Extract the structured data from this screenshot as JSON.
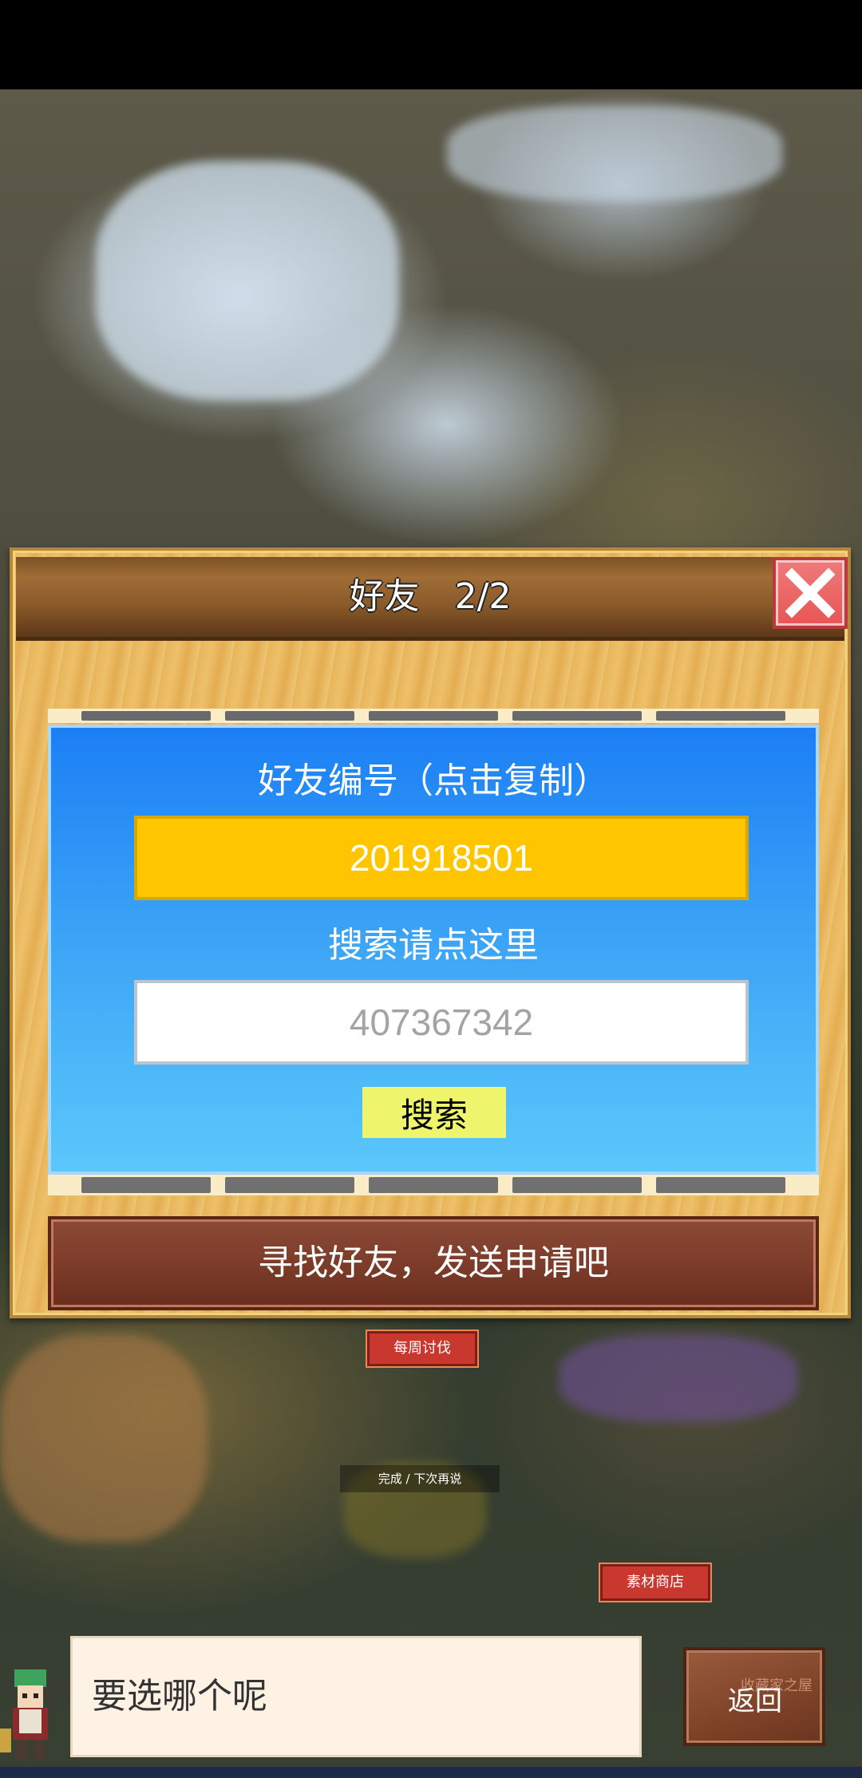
{
  "dialog": {
    "title": "好友　2/2",
    "friend_id_label": "好友编号（点击复制）",
    "friend_id": "201918501",
    "search_label": "搜索请点这里",
    "search_placeholder": "407367342",
    "search_button": "搜索",
    "find_friends_text": "寻找好友，发送申请吧"
  },
  "world": {
    "weekly_tag": "每周讨伐",
    "complete_tag": "完成 / 下次再说",
    "material_shop_tag": "素材商店"
  },
  "bottom": {
    "speech_text": "要选哪个呢",
    "back_subtitle": "收藏家之屋",
    "back_label": "返回"
  },
  "colors": {
    "panel_blue": "#1b7ff5",
    "id_box": "#ffc600",
    "search_button": "#eef56d",
    "close_red": "#e85555",
    "banner_brown": "#7b3b28",
    "arrow_green": "#c9e22e"
  }
}
